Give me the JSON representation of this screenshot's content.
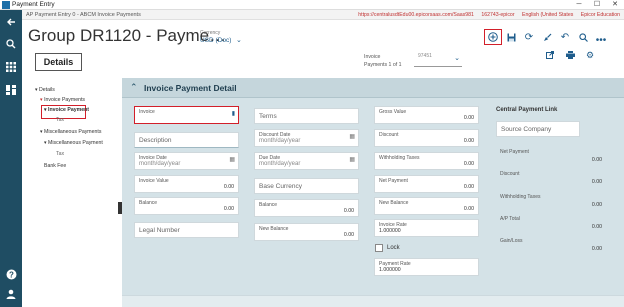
{
  "window": {
    "title": "Payment Entry",
    "minimize": "─",
    "maximize": "☐",
    "close": "✕"
  },
  "topbar": {
    "breadcrumb": "AP Payment Entry 0 - ABCM Invoice Payments",
    "url": "https://centralusdtEdu00.epicorsaas.com/Saas981",
    "session": "162743-epicor",
    "locale": "English (United States",
    "product": "Epicor Education"
  },
  "header": {
    "title": "Group DR1120 - Payme…",
    "currency_label": "Currency",
    "currency_value": "USD (Doc)",
    "details_button": "Details",
    "invoice_label": "Invoice",
    "invoice_counter": "Payments 1 of 1",
    "invoice_select": "97451"
  },
  "tree": {
    "details": "Details",
    "invoice_payments": "Invoice Payments",
    "invoice_payment": "Invoice Payment",
    "tax1": "Tax",
    "misc_payments": "Miscellaneous Payments",
    "misc_payment": "Miscellaneous Payment",
    "tax2": "Tax",
    "bank_fee": "Bank Fee"
  },
  "section": {
    "title": "Invoice Payment Detail"
  },
  "fields": {
    "invoice_label": "Invoice",
    "description": "Description",
    "invoice_date_label": "Invoice Date",
    "invoice_date_ph": "month/day/year",
    "invoice_value_label": "Invoice Value",
    "invoice_value": "0.00",
    "balance_label": "Balance",
    "balance_value": "0.00",
    "legal_number": "Legal Number",
    "terms": "Terms",
    "discount_date_label": "Discount Date",
    "discount_date_ph": "month/day/year",
    "due_date_label": "Due Date",
    "due_date_ph": "month/day/year",
    "base_currency": "Base Currency",
    "balance2_label": "Balance",
    "balance2_value": "0.00",
    "new_balance_label": "New Balance",
    "new_balance_value": "0.00",
    "gross_value_label": "Gross Value",
    "gross_value": "0.00",
    "discount_label": "Discount",
    "discount_value": "0.00",
    "withholding_label": "Withholding Taxes",
    "withholding_value": "0.00",
    "net_payment_label": "Net Payment",
    "net_payment_value": "0.00",
    "new_balance3_label": "New Balance",
    "new_balance3_value": "0.00",
    "invoice_rate_label": "Invoice Rate",
    "invoice_rate_value": "1.000000",
    "lock_label": "Lock",
    "payment_rate_label": "Payment Rate",
    "payment_rate_value": "1.000000"
  },
  "central": {
    "title": "Central Payment Link",
    "source_company": "Source Company",
    "net_payment_label": "Net Payment",
    "net_payment_value": "0.00",
    "discount_label": "Discount",
    "discount_value": "0.00",
    "withholding_label": "Withholding Taxes",
    "withholding_value": "0.00",
    "ap_total_label": "A/P Total",
    "ap_total_value": "0.00",
    "gain_loss_label": "Gain/Loss",
    "gain_loss_value": "0.00"
  },
  "colors": {
    "sidebar": "#1f4d63",
    "highlight": "#d21f2a",
    "accent": "#1f5d8c",
    "panel": "#d4e2e7"
  }
}
